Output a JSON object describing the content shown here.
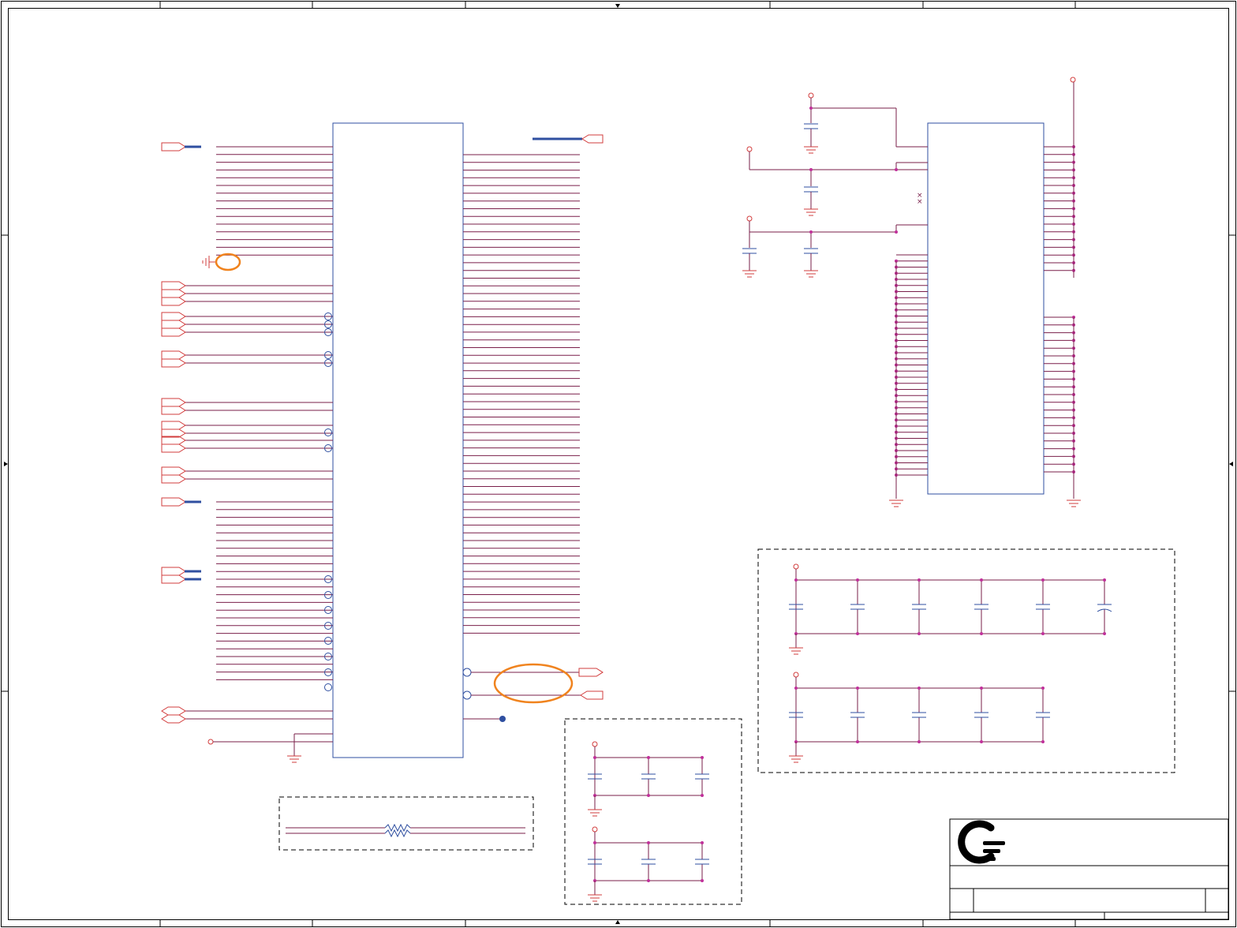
{
  "diagram": {
    "kind": "schematic",
    "colors": {
      "wire": "#7a1f4a",
      "component": "#2f4fa0",
      "port": "#d23c3c",
      "junction": "#c0309a",
      "highlight": "#f0831e",
      "frame": "#000000"
    },
    "title_block": {
      "logo": "company-logo-icon"
    }
  }
}
